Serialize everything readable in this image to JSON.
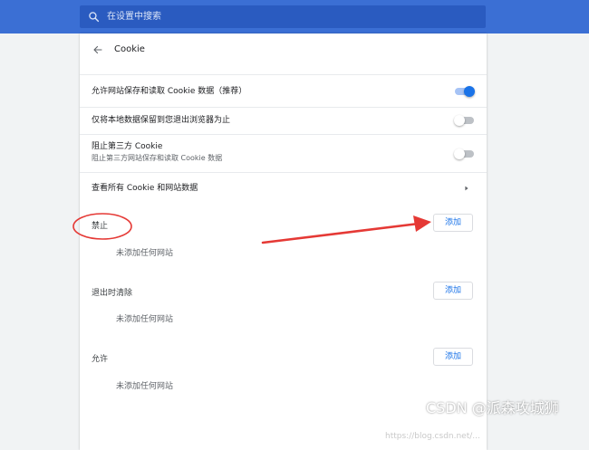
{
  "search": {
    "placeholder": "在设置中搜索"
  },
  "header": {
    "title": "Cookie"
  },
  "settings": [
    {
      "title": "允许网站保存和读取 Cookie 数据（推荐）",
      "toggle": "on"
    },
    {
      "title": "仅将本地数据保留到您退出浏览器为止",
      "toggle": "off"
    },
    {
      "title": "阻止第三方 Cookie",
      "subtitle": "阻止第三方网站保存和读取 Cookie 数据",
      "toggle": "off"
    },
    {
      "title": "查看所有 Cookie 和网站数据"
    }
  ],
  "sections": [
    {
      "title": "禁止",
      "button": "添加",
      "empty": "未添加任何网站"
    },
    {
      "title": "退出时清除",
      "button": "添加",
      "empty": "未添加任何网站"
    },
    {
      "title": "允许",
      "button": "添加",
      "empty": "未添加任何网站"
    }
  ],
  "colors": {
    "accent": "#1a73e8",
    "topbar": "#3b6fd4",
    "annotation": "#e53935"
  },
  "watermark": {
    "text": "CSDN @派森攻城狮",
    "faint": "https://blog.csdn.net/..."
  }
}
